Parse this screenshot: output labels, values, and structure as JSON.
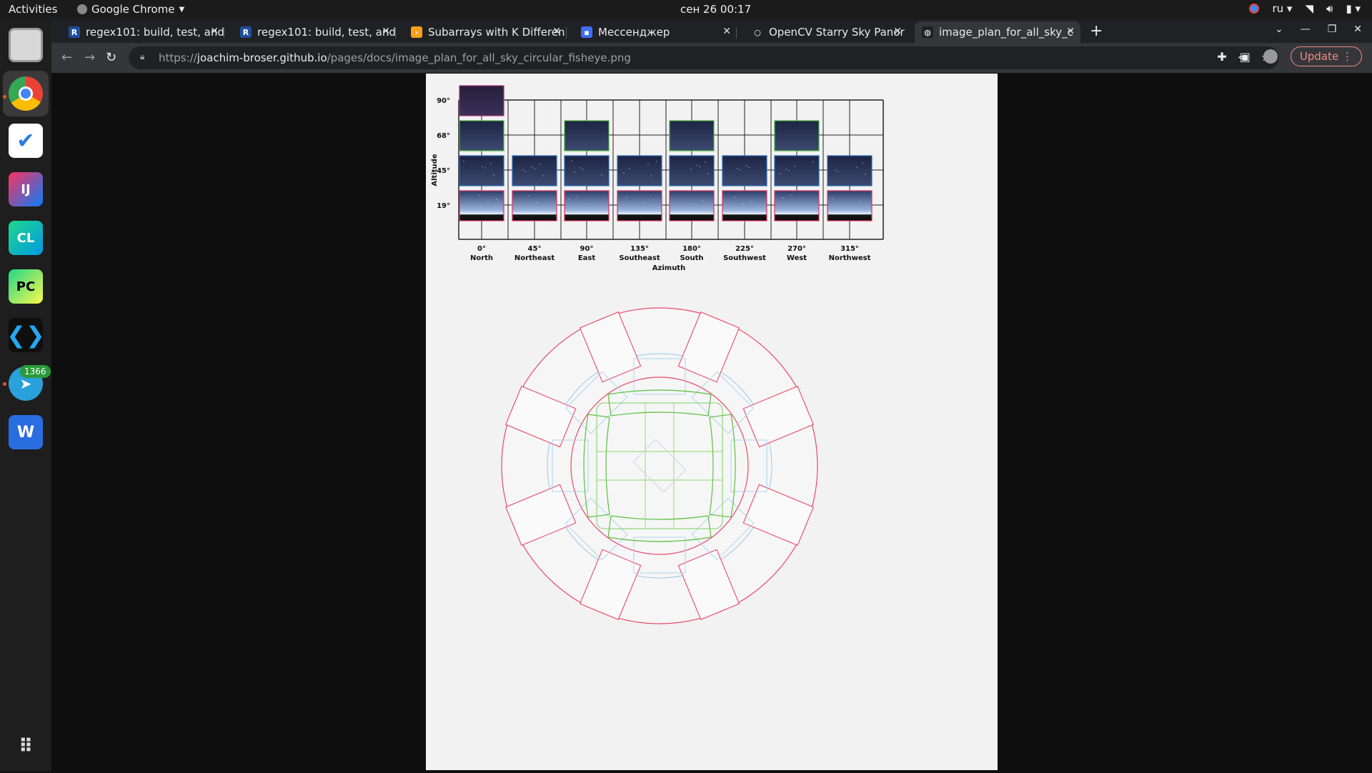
{
  "topbar": {
    "activities": "Activities",
    "app_name": "Google Chrome",
    "clock": "сен 26  00:17",
    "lang": "ru"
  },
  "dock": {
    "apps": [
      "files-icon",
      "chrome-icon",
      "tasks-icon",
      "intellij-icon",
      "clion-icon",
      "pycharm-icon",
      "vscode-icon",
      "telegram-icon",
      "wps-icon",
      "app-grid-icon"
    ],
    "telegram_badge": "1366"
  },
  "tabs": [
    {
      "title": "regex101: build, test, and",
      "fav": "R",
      "fav_color": "#1e4fa0"
    },
    {
      "title": "regex101: build, test, and",
      "fav": "R",
      "fav_color": "#1e4fa0"
    },
    {
      "title": "Subarrays with K Differen",
      "fav": "›",
      "fav_color": "#f89f1b"
    },
    {
      "title": "Мессенджер",
      "fav": "▪",
      "fav_color": "#3d6ef5"
    },
    {
      "title": "OpenCV Starry Sky Panor",
      "fav": "○",
      "fav_color": "#202124"
    },
    {
      "title": "image_plan_for_all_sky_c",
      "fav": "◍",
      "fav_color": "#202124"
    }
  ],
  "address": {
    "scheme": "https://",
    "host": "joachim-broser.github.io",
    "path": "/pages/docs/image_plan_for_all_sky_circular_fisheye.png"
  },
  "update_label": "Update",
  "image": {
    "altitudes": [
      "90°",
      "68°",
      "45°",
      "19°"
    ],
    "altitude_label": "Altitude",
    "azimuths": [
      {
        "deg": "0°",
        "dir": "North"
      },
      {
        "deg": "45°",
        "dir": "Northeast"
      },
      {
        "deg": "90°",
        "dir": "East"
      },
      {
        "deg": "135°",
        "dir": "Southeast"
      },
      {
        "deg": "180°",
        "dir": "South"
      },
      {
        "deg": "225°",
        "dir": "Southwest"
      },
      {
        "deg": "270°",
        "dir": "West"
      },
      {
        "deg": "315°",
        "dir": "Northwest"
      }
    ],
    "azimuth_label": "Azimuth",
    "frame_colors": {
      "zenith": "#b03070",
      "mid_high": "#4ab040",
      "mid": "#2a6ab8",
      "horizon": "#e03060"
    },
    "tiles_per_row": [
      1,
      4,
      8,
      8
    ]
  }
}
